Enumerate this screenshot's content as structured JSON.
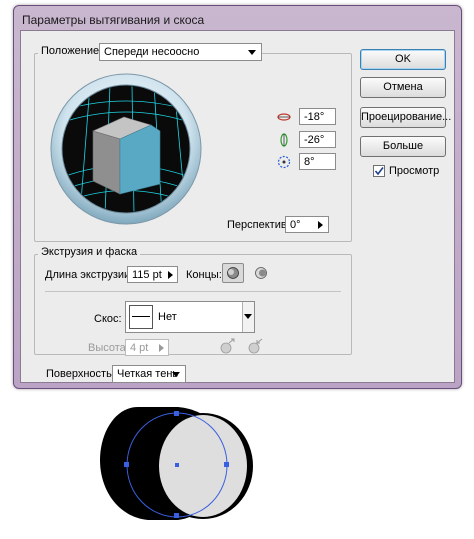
{
  "dialog": {
    "title": "Параметры вытягивания и скоса",
    "position_label": "Положение:",
    "position_value": "Спереди несоосно",
    "rot_x": "-18°",
    "rot_y": "-26°",
    "rot_z": "8°",
    "perspective_label": "Перспектива:",
    "perspective_value": "0°",
    "extrude_group_label": "Экструзия и фаска",
    "extrude_depth_label": "Длина экструзии:",
    "extrude_depth_value": "115 pt",
    "caps_label": "Концы:",
    "bevel_label": "Скос:",
    "bevel_value": "Нет",
    "height_label": "Высота:",
    "height_value": "4 pt",
    "surface_label": "Поверхность:",
    "surface_value": "Четкая тень"
  },
  "buttons": {
    "ok": "OK",
    "cancel": "Отмена",
    "map": "Проецирование...",
    "more": "Больше",
    "preview_label": "Просмотр",
    "preview_checked": true
  },
  "colors": {
    "cube_front": "#5aa9c4",
    "cube_top": "#bdbdbd",
    "cube_side": "#8d8d8d",
    "grid": "#1fd6e6",
    "selection": "#3a5fe0"
  }
}
